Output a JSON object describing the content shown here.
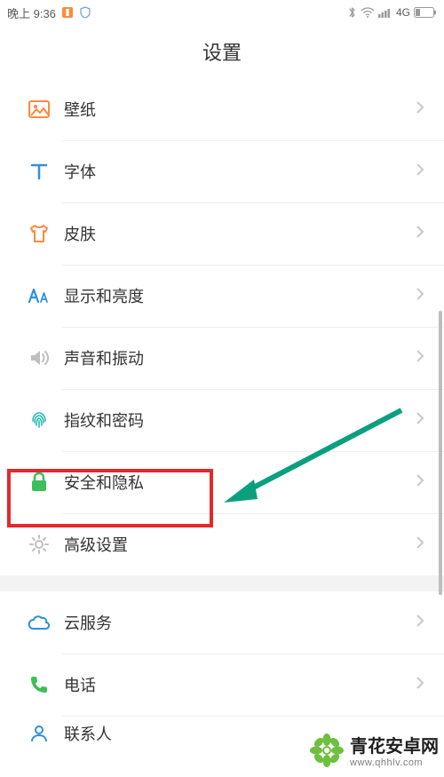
{
  "status": {
    "time": "晚上 9:36",
    "network": "4G"
  },
  "title": "设置",
  "rows": {
    "wallpaper": "壁纸",
    "font": "字体",
    "skin": "皮肤",
    "display": "显示和亮度",
    "sound": "声音和振动",
    "fingerprint": "指纹和密码",
    "security": "安全和隐私",
    "advanced": "高级设置",
    "cloud": "云服务",
    "phone": "电话",
    "contacts": "联系人"
  },
  "colors": {
    "accent_orange": "#ff8a3d",
    "accent_blue": "#2f8fe0",
    "accent_green": "#3cbf5a",
    "accent_gray": "#bfbfbf",
    "accent_teal": "#27b8af",
    "highlight_red": "#e62828",
    "arrow_teal": "#0aa07f"
  },
  "watermark": {
    "name": "青花安卓网",
    "url": "www.qhhlv.com"
  }
}
